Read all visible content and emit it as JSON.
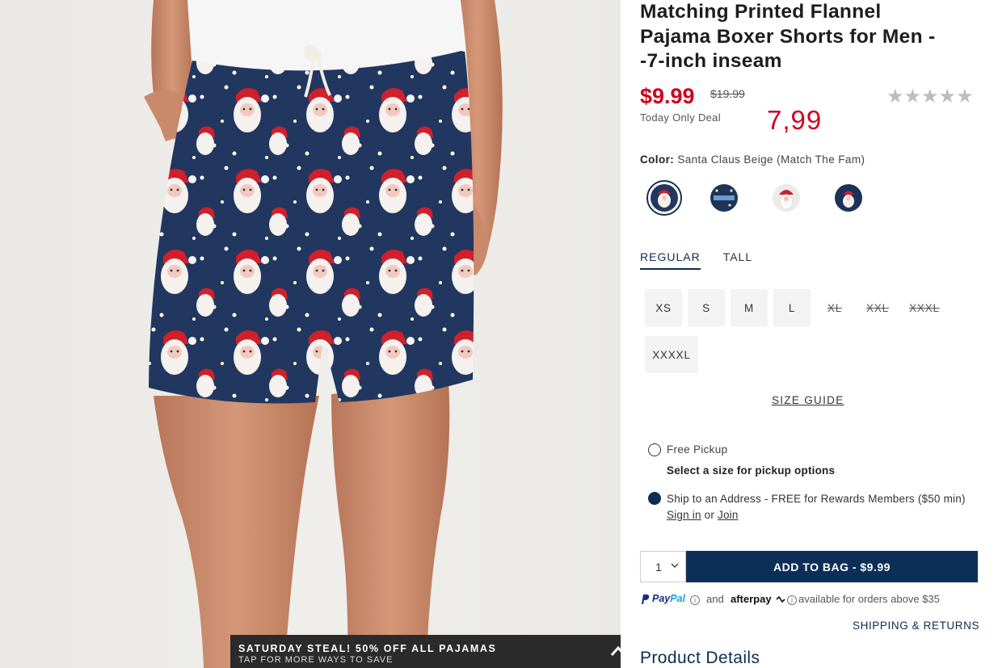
{
  "product": {
    "title_line1": "Matching Printed Flannel",
    "title_line2": "Pajama Boxer Shorts for Men -",
    "title_line3": "-7-inch inseam",
    "price": "$9.99",
    "original_price": "$19.99",
    "deal_label": "Today Only Deal",
    "alt_price": "7,99",
    "rating_stars": 0,
    "rating_max": 5
  },
  "color": {
    "label": "Color:",
    "value": "Santa Claus Beige (Match The Fam)",
    "swatches": [
      {
        "name": "Santa Claus Beige",
        "selected": true
      },
      {
        "name": "Navy Print",
        "selected": false
      },
      {
        "name": "Santa White",
        "selected": false
      },
      {
        "name": "Santa Navy",
        "selected": false
      }
    ]
  },
  "fit": {
    "tabs": [
      {
        "label": "REGULAR",
        "active": true
      },
      {
        "label": "TALL",
        "active": false
      }
    ]
  },
  "sizes": [
    {
      "label": "XS",
      "available": true
    },
    {
      "label": "S",
      "available": true
    },
    {
      "label": "M",
      "available": true
    },
    {
      "label": "L",
      "available": true
    },
    {
      "label": "XL",
      "available": false
    },
    {
      "label": "XXL",
      "available": false
    },
    {
      "label": "XXXL",
      "available": false
    },
    {
      "label": "XXXXL",
      "available": true
    }
  ],
  "size_guide": "SIZE GUIDE",
  "fulfillment": {
    "pickup_label": "Free Pickup",
    "pickup_sub": "Select a size for pickup options",
    "ship_text": "Ship to an Address - FREE for Rewards Members ($50 min)",
    "sign_in": "Sign in",
    "or": "or",
    "join": "Join"
  },
  "cart": {
    "quantity": "1",
    "add_label": "ADD TO BAG  -  $9.99"
  },
  "payments": {
    "paypal_a": "Pay",
    "paypal_b": "Pal",
    "and": "and",
    "afterpay": "afterpay",
    "available": "available for orders above $35"
  },
  "shipping_returns": "SHIPPING & RETURNS",
  "product_details": "Product Details",
  "promo": {
    "title": "SATURDAY STEAL! 50% OFF ALL PAJAMAS",
    "subtitle": "TAP FOR MORE WAYS TO SAVE"
  },
  "colors": {
    "price_red": "#d0021b",
    "navy": "#0c2f57",
    "shorts": "#22375f"
  }
}
